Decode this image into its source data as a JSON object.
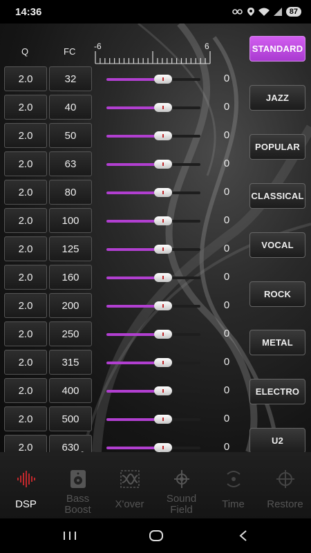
{
  "status": {
    "time": "14:36",
    "battery": "87"
  },
  "headers": {
    "q": "Q",
    "fc": "FC",
    "scale_min": "-6",
    "scale_max": "6"
  },
  "bands": [
    {
      "q": "2.0",
      "fc": "32",
      "gain": "0",
      "level": 0.5
    },
    {
      "q": "2.0",
      "fc": "40",
      "gain": "0",
      "level": 0.5
    },
    {
      "q": "2.0",
      "fc": "50",
      "gain": "0",
      "level": 0.5
    },
    {
      "q": "2.0",
      "fc": "63",
      "gain": "0",
      "level": 0.5
    },
    {
      "q": "2.0",
      "fc": "80",
      "gain": "0",
      "level": 0.5
    },
    {
      "q": "2.0",
      "fc": "100",
      "gain": "0",
      "level": 0.5
    },
    {
      "q": "2.0",
      "fc": "125",
      "gain": "0",
      "level": 0.5
    },
    {
      "q": "2.0",
      "fc": "160",
      "gain": "0",
      "level": 0.5
    },
    {
      "q": "2.0",
      "fc": "200",
      "gain": "0",
      "level": 0.5
    },
    {
      "q": "2.0",
      "fc": "250",
      "gain": "0",
      "level": 0.5
    },
    {
      "q": "2.0",
      "fc": "315",
      "gain": "0",
      "level": 0.5
    },
    {
      "q": "2.0",
      "fc": "400",
      "gain": "0",
      "level": 0.5
    },
    {
      "q": "2.0",
      "fc": "500",
      "gain": "0",
      "level": 0.5
    },
    {
      "q": "2.0",
      "fc": "630",
      "gain": "0",
      "level": 0.5
    }
  ],
  "presets": [
    {
      "label": "STANDARD",
      "active": true
    },
    {
      "label": "JAZZ",
      "active": false
    },
    {
      "label": "POPULAR",
      "active": false
    },
    {
      "label": "CLASSICAL",
      "active": false
    },
    {
      "label": "VOCAL",
      "active": false
    },
    {
      "label": "ROCK",
      "active": false
    },
    {
      "label": "METAL",
      "active": false
    },
    {
      "label": "ELECTRO",
      "active": false
    },
    {
      "label": "U2",
      "active": false
    }
  ],
  "tabs": [
    {
      "label": "DSP",
      "icon": "waveform-icon",
      "active": true
    },
    {
      "label": "Bass\nBoost",
      "icon": "speaker-icon",
      "active": false
    },
    {
      "label": "X'over",
      "icon": "crossover-icon",
      "active": false
    },
    {
      "label": "Sound\nField",
      "icon": "sound-field-icon",
      "active": false
    },
    {
      "label": "Time",
      "icon": "time-delay-icon",
      "active": false
    },
    {
      "label": "Restore",
      "icon": "target-icon",
      "active": false
    }
  ],
  "colors": {
    "accent": "#b13fd0",
    "preset_active": "#c24de4"
  }
}
